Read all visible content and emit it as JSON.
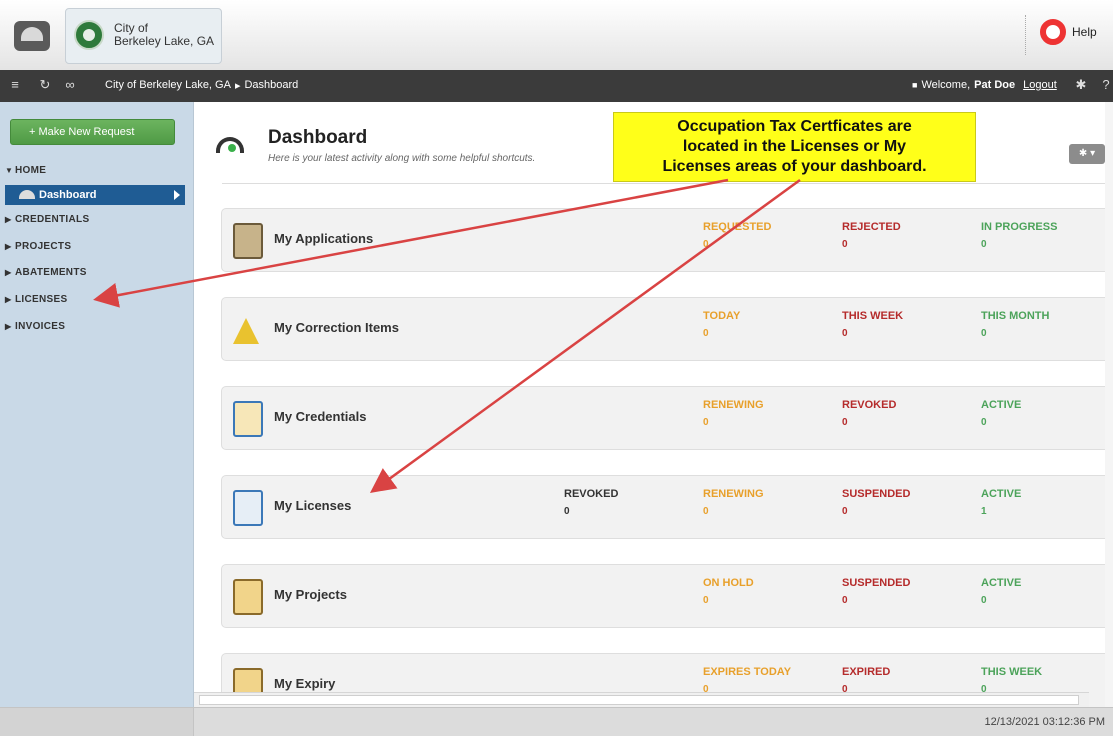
{
  "header": {
    "city_line1": "City of",
    "city_line2": "Berkeley Lake, GA",
    "help_label": "Help"
  },
  "navbar": {
    "breadcrumb": [
      "City of Berkeley Lake, GA",
      "▸",
      "Dashboard"
    ],
    "welcome_prefix": "Welcome,",
    "user_name": "Pat Doe",
    "logout_label": "Logout"
  },
  "sidebar": {
    "new_request_label": "+ Make New Request",
    "home_label": "HOME",
    "dashboard_label": "Dashboard",
    "items": [
      "CREDENTIALS",
      "PROJECTS",
      "ABATEMENTS",
      "LICENSES",
      "INVOICES"
    ]
  },
  "main": {
    "title": "Dashboard",
    "subtitle": "Here is your latest activity along with some helpful shortcuts.",
    "cards": [
      {
        "title": "My Applications",
        "icon": "application-icon",
        "stats": [
          {
            "label": "REQUESTED",
            "value": "0",
            "color": "orange"
          },
          {
            "label": "REJECTED",
            "value": "0",
            "color": "red"
          },
          {
            "label": "IN PROGRESS",
            "value": "0",
            "color": "green"
          }
        ]
      },
      {
        "title": "My Correction Items",
        "icon": "warning-icon",
        "stats": [
          {
            "label": "TODAY",
            "value": "0",
            "color": "orange"
          },
          {
            "label": "THIS WEEK",
            "value": "0",
            "color": "red"
          },
          {
            "label": "THIS MONTH",
            "value": "0",
            "color": "green"
          }
        ]
      },
      {
        "title": "My Credentials",
        "icon": "certificate-icon",
        "stats": [
          {
            "label": "RENEWING",
            "value": "0",
            "color": "orange"
          },
          {
            "label": "REVOKED",
            "value": "0",
            "color": "red"
          },
          {
            "label": "ACTIVE",
            "value": "0",
            "color": "green"
          }
        ]
      },
      {
        "title": "My Licenses",
        "icon": "license-icon",
        "stats": [
          {
            "label": "REVOKED",
            "value": "0",
            "color": "dark"
          },
          {
            "label": "RENEWING",
            "value": "0",
            "color": "orange"
          },
          {
            "label": "SUSPENDED",
            "value": "0",
            "color": "red"
          },
          {
            "label": "ACTIVE",
            "value": "1",
            "color": "green"
          }
        ]
      },
      {
        "title": "My Projects",
        "icon": "projects-icon",
        "stats": [
          {
            "label": "ON HOLD",
            "value": "0",
            "color": "orange"
          },
          {
            "label": "SUSPENDED",
            "value": "0",
            "color": "red"
          },
          {
            "label": "ACTIVE",
            "value": "0",
            "color": "green"
          }
        ]
      },
      {
        "title": "My Expiry",
        "icon": "expiry-icon",
        "stats": [
          {
            "label": "EXPIRES TODAY",
            "value": "0",
            "color": "orange"
          },
          {
            "label": "EXPIRED",
            "value": "0",
            "color": "red"
          },
          {
            "label": "THIS WEEK",
            "value": "0",
            "color": "green"
          }
        ]
      }
    ]
  },
  "callout": {
    "lines": [
      "Occupation Tax Certficates are",
      "located in the Licenses or My",
      "Licenses areas of your dashboard."
    ]
  },
  "footer": {
    "timestamp": "12/13/2021 03:12:36 PM"
  },
  "colors": {
    "accent": "#1f5c94",
    "orange": "#e8a02b",
    "red": "#b52b2b",
    "green": "#4ca35a",
    "callout": "#ffff19",
    "arrow": "#d94343"
  }
}
